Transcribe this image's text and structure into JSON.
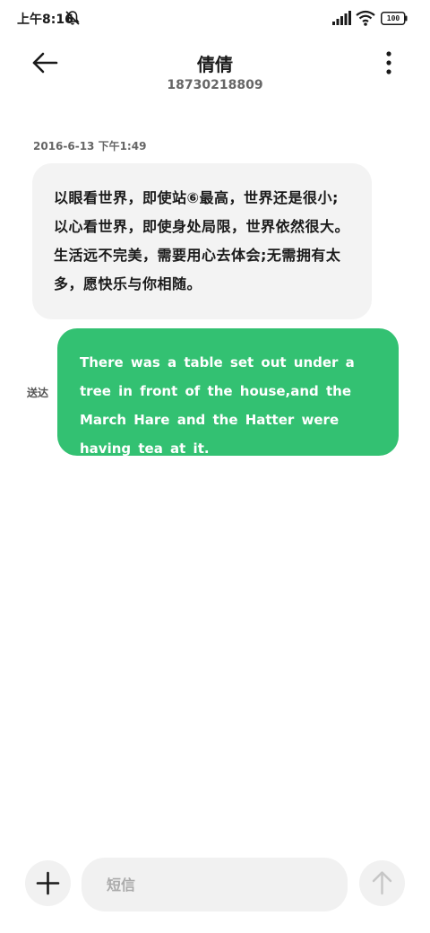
{
  "status_bar": {
    "time": "上午8:16",
    "battery_level": "100",
    "icons": [
      "notification-muted-icon",
      "signal-icon",
      "wifi-icon",
      "battery-icon"
    ]
  },
  "header": {
    "contact_name": "倩倩",
    "phone_number": "18730218809",
    "icons": [
      "back-arrow-icon",
      "more-vertical-icon"
    ]
  },
  "conversation": {
    "timestamp": "2016-6-13 下午1:49",
    "received_message": "以眼看世界，即使站⑥最高，世界还是很小;以心看世界，即使身处局限，世界依然很大。生活远不完美，需要用心去体会;无需拥有太多，愿快乐与你相随。",
    "sent_message": "There was a table set out under a tree in front of the house,and the March Hare and the Hatter were having tea at it.",
    "sent_status": "送达"
  },
  "composer": {
    "input_value": "",
    "input_placeholder": "短信",
    "icons": [
      "plus-icon",
      "send-arrow-up-icon"
    ]
  },
  "colors": {
    "sent_bubble": "#33c172",
    "received_bubble": "#f3f3f3",
    "background": "#ffffff"
  }
}
